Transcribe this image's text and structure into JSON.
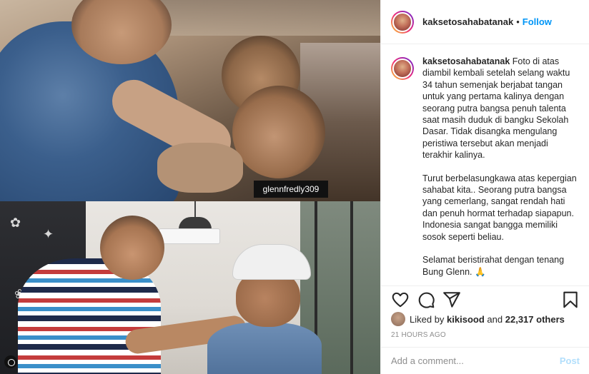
{
  "post": {
    "photo_watermark": "glennfredly309",
    "username": "kaksetosahabatanak",
    "separator": "•",
    "follow_label": "Follow"
  },
  "caption": {
    "username": "kaksetosahabatanak",
    "paragraph1": "Foto di atas diambil kembali setelah selang waktu 34 tahun semenjak berjabat tangan untuk yang pertama kalinya dengan seorang putra bangsa penuh talenta saat masih duduk di bangku Sekolah Dasar. Tidak disangka mengulang peristiwa tersebut akan menjadi terakhir kalinya.",
    "paragraph2": "Turut berbelasungkawa atas kepergian sahabat kita.. Seorang putra bangsa yang cemerlang, sangat rendah hati dan penuh hormat terhadap siapapun. Indonesia sangat bangga memiliki sosok seperti beliau.",
    "paragraph3": "Selamat beristirahat dengan tenang Bung Glenn. 🙏"
  },
  "icons": {
    "like": "heart-icon",
    "comment": "comment-icon",
    "share": "share-icon",
    "save": "bookmark-icon"
  },
  "likes": {
    "prefix": "Liked by",
    "user": "kikisood",
    "conjunction": "and",
    "others": "22,317 others"
  },
  "timestamp": "21 HOURS AGO",
  "comment": {
    "placeholder": "Add a comment...",
    "post_label": "Post"
  },
  "colors": {
    "accent": "#0095f6",
    "post_disabled": "#b2dffc",
    "muted": "#8e8e8e"
  }
}
